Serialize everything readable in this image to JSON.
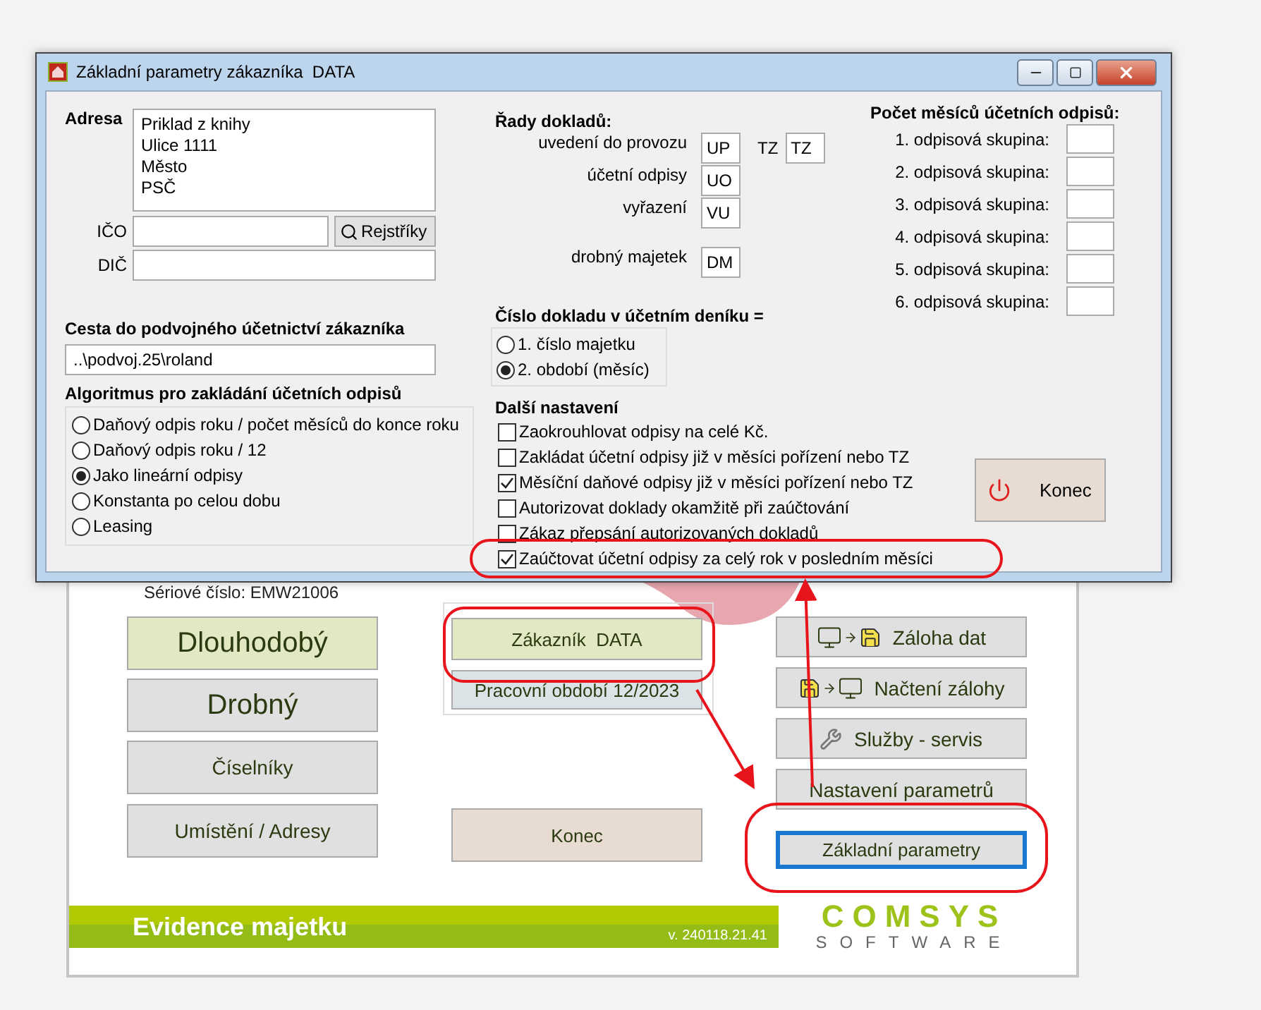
{
  "dialog": {
    "title": "Základní parametry zákazníka  DATA",
    "address": {
      "label": "Adresa",
      "lines": [
        "Priklad z knihy",
        "Ulice 1111",
        "Město",
        "PSČ"
      ]
    },
    "ico": {
      "label": "IČO"
    },
    "registry_button": "Rejstříky",
    "dic": {
      "label": "DIČ"
    },
    "path": {
      "label": "Cesta do podvojného účetnictví zákazníka",
      "value": "..\\podvoj.25\\roland"
    },
    "algorithm": {
      "label": "Algoritmus pro zakládání účetních odpisů",
      "options": [
        {
          "label": "Daňový odpis roku / počet měsíců do konce roku",
          "selected": false
        },
        {
          "label": "Daňový odpis roku / 12",
          "selected": false
        },
        {
          "label": "Jako lineární odpisy",
          "selected": true
        },
        {
          "label": "Konstanta po celou dobu",
          "selected": false
        },
        {
          "label": "Leasing",
          "selected": false
        }
      ]
    },
    "series": {
      "label": "Řady dokladů:",
      "rows": [
        {
          "label": "uvedení do provozu",
          "value": "UP",
          "extra_label": "TZ",
          "extra_value": "TZ"
        },
        {
          "label": "účetní odpisy",
          "value": "UO"
        },
        {
          "label": "vyřazení",
          "value": "VU"
        },
        {
          "label": "drobný majetek",
          "value": "DM"
        }
      ]
    },
    "document_number": {
      "label": "Číslo dokladu v účetním deníku =",
      "options": [
        {
          "label": "1. číslo majetku",
          "selected": false
        },
        {
          "label": "2. období (měsíc)",
          "selected": true
        }
      ]
    },
    "other_settings": {
      "label": "Další nastavení",
      "options": [
        {
          "label": "Zaokrouhlovat odpisy na celé Kč.",
          "checked": false
        },
        {
          "label": "Zakládat účetní odpisy již v měsíci pořízení nebo TZ",
          "checked": false
        },
        {
          "label": "Měsíční daňové odpisy již v měsíci pořízení nebo TZ",
          "checked": true
        },
        {
          "label": "Autorizovat doklady okamžitě při zaúčtování",
          "checked": false
        },
        {
          "label": "Zákaz přepsání autorizovaných dokladů",
          "checked": false
        },
        {
          "label": "Zaúčtovat účetní odpisy za celý rok v posledním měsíci",
          "checked": true
        }
      ]
    },
    "months": {
      "label": "Počet měsíců účetních odpisů:",
      "groups": [
        {
          "label": "1. odpisová skupina:"
        },
        {
          "label": "2. odpisová skupina:"
        },
        {
          "label": "3. odpisová skupina:"
        },
        {
          "label": "4. odpisová skupina:"
        },
        {
          "label": "5. odpisová skupina:"
        },
        {
          "label": "6. odpisová skupina:"
        }
      ]
    },
    "exit_button": "Konec"
  },
  "main": {
    "serial": "Sériové číslo: EMW21006",
    "left_buttons": [
      {
        "label": "Dlouhodobý",
        "kind": "primary"
      },
      {
        "label": "Drobný",
        "kind": "large"
      },
      {
        "label": "Číselníky",
        "kind": "normal"
      },
      {
        "label": "Umístění / Adresy",
        "kind": "normal"
      }
    ],
    "customer_button": "Zákazník  DATA",
    "period_button": "Pracovní období 12/2023",
    "exit_button": "Konec",
    "right_buttons": [
      {
        "label": "Záloha dat",
        "kind": "backup"
      },
      {
        "label": "Načtení zálohy",
        "kind": "restore"
      },
      {
        "label": "Služby - servis",
        "kind": "service"
      },
      {
        "label": "Nastavení parametrů",
        "kind": "plain"
      },
      {
        "label": "Základní parametry",
        "kind": "focused"
      }
    ],
    "banner": {
      "title": "Evidence majetku",
      "version": "v. 240118.21.41"
    },
    "logo": {
      "name": "COMSYS",
      "tagline": "SOFTWARE"
    }
  }
}
